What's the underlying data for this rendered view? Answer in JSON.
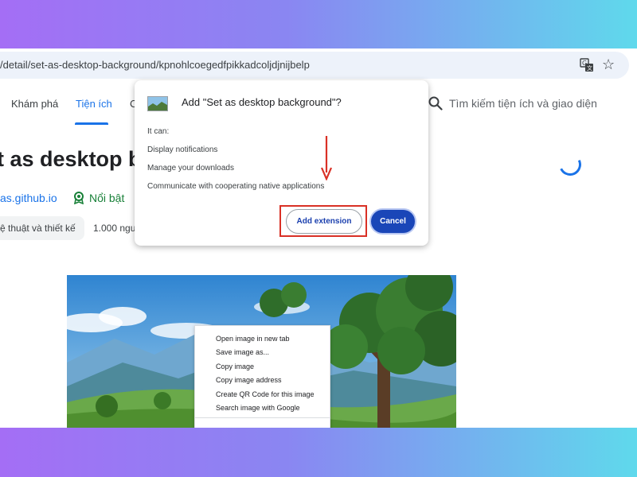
{
  "browser": {
    "url": "/detail/set-as-desktop-background/kpnohlcoegedfpikkadcoljdjnijbelp",
    "translate_icon": "translate-icon",
    "bookmark_icon": "star-icon"
  },
  "store_nav": {
    "items": [
      "Khám phá",
      "Tiện ích",
      "C"
    ],
    "active": "Tiện ích",
    "search_placeholder": "Tìm kiếm tiện ích và giao diện"
  },
  "extension": {
    "title": "t as desktop b",
    "site": "as.github.io",
    "featured_label": "Nổi bật",
    "category": "ệ thuật và thiết kế",
    "users": "1.000 ngu"
  },
  "dialog": {
    "title": "Add \"Set as desktop background\"?",
    "it_can": "It can:",
    "permissions": [
      "Display notifications",
      "Manage your downloads",
      "Communicate with cooperating native applications"
    ],
    "add_button": "Add extension",
    "cancel_button": "Cancel"
  },
  "context_menu": {
    "items": [
      "Open image in new tab",
      "Save image as...",
      "Copy image",
      "Copy image address",
      "Create QR Code for this image",
      "Search image with Google"
    ]
  },
  "colors": {
    "accent": "#1a73e8",
    "highlight": "#d93025",
    "cancel_button": "#1a46b8",
    "page_gradient_start": "#a46ef5",
    "page_gradient_end": "#5fd9ec"
  }
}
